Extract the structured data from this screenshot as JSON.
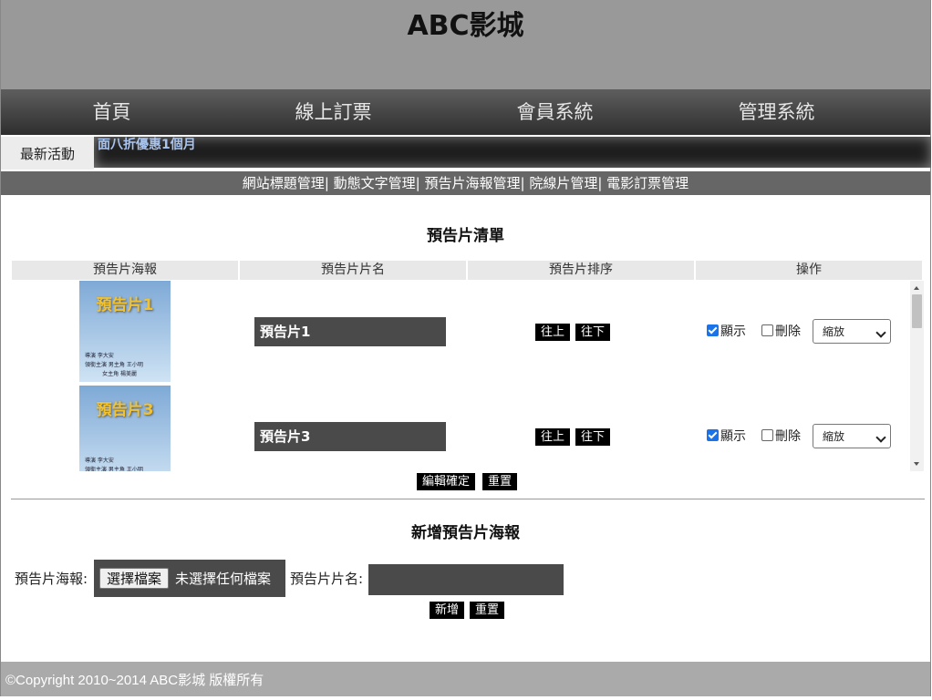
{
  "header": {
    "site_title": "ABC影城"
  },
  "nav": {
    "items": [
      "首頁",
      "線上訂票",
      "會員系統",
      "管理系統"
    ]
  },
  "ticker": {
    "label": "最新活動",
    "text": "面八折優惠1個月"
  },
  "admin_menu": {
    "items": [
      "網站標題管理",
      "動態文字管理",
      "預告片海報管理",
      "院線片管理",
      "電影訂票管理"
    ],
    "separator": "| "
  },
  "trailer_list": {
    "heading": "預告片清單",
    "columns": [
      "預告片海報",
      "預告片片名",
      "預告片排序",
      "操作"
    ],
    "rows": [
      {
        "poster_title": "預告片1",
        "poster_credits": "導演 李大安\n領銜主演 男主角 王小明\n          女主角 楊美麗",
        "name": "預告片1",
        "move_up": "往上",
        "move_down": "往下",
        "show_label": "顯示",
        "show_checked": true,
        "delete_label": "刪除",
        "delete_checked": false,
        "effect": "縮放"
      },
      {
        "poster_title": "預告片3",
        "poster_credits": "導演 李大安\n領銜主演 男主角 王小明",
        "name": "預告片3",
        "move_up": "往上",
        "move_down": "往下",
        "show_label": "顯示",
        "show_checked": true,
        "delete_label": "刪除",
        "delete_checked": false,
        "effect": "縮放"
      }
    ],
    "submit_label": "編輯確定",
    "reset_label": "重置"
  },
  "add_form": {
    "heading": "新增預告片海報",
    "poster_label": "預告片海報:",
    "file_button": "選擇檔案",
    "file_status": "未選擇任何檔案",
    "name_label": "預告片片名:",
    "name_value": "",
    "add_label": "新增",
    "reset_label": "重置"
  },
  "footer": {
    "text": "©Copyright 2010~2014 ABC影城 版權所有"
  }
}
